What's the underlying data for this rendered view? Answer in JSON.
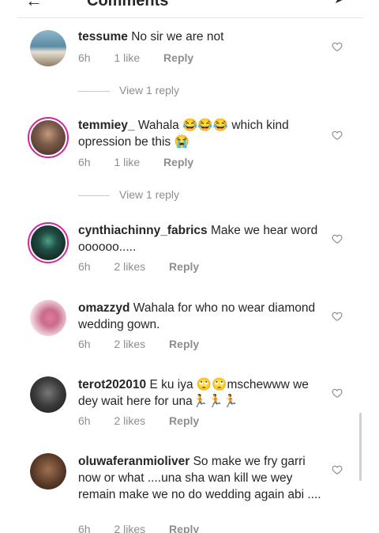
{
  "header": {
    "title": "Comments"
  },
  "comments": [
    {
      "username": "tessume",
      "text": "No sir we are not",
      "time": "6h",
      "likes": "1 like",
      "reply": "Reply",
      "view_replies": "View 1 reply",
      "avatar_color": "#5b8ba6"
    },
    {
      "username": "temmiey_",
      "text": "Wahala 😂😂😂 which kind opression be this 😭",
      "time": "6h",
      "likes": "1 like",
      "reply": "Reply",
      "view_replies": "View 1 reply",
      "avatar_color": "#7a5a4a"
    },
    {
      "username": "cynthiachinny_fabrics",
      "text": "Make we hear word oooooo.....",
      "time": "6h",
      "likes": "2 likes",
      "reply": "Reply",
      "avatar_color": "#1f4f45"
    },
    {
      "username": "omazzyd",
      "text": "Wahala for who no wear diamond wedding gown.",
      "time": "6h",
      "likes": "2 likes",
      "reply": "Reply",
      "avatar_color": "#c96b8a"
    },
    {
      "username": "terot202010",
      "text": "E ku iya 🙄🙄mschewww we dey wait here for una🏃🏃🏃",
      "time": "6h",
      "likes": "2 likes",
      "reply": "Reply",
      "avatar_color": "#3a3a3a"
    },
    {
      "username": "oluwaferanmioliver",
      "text": "So make we fry garri now or what ....una sha wan kill we wey remain make we no do wedding again abi ....",
      "time": "6h",
      "likes": "2 likes",
      "reply": "Reply",
      "avatar_color": "#5a3a28"
    }
  ]
}
